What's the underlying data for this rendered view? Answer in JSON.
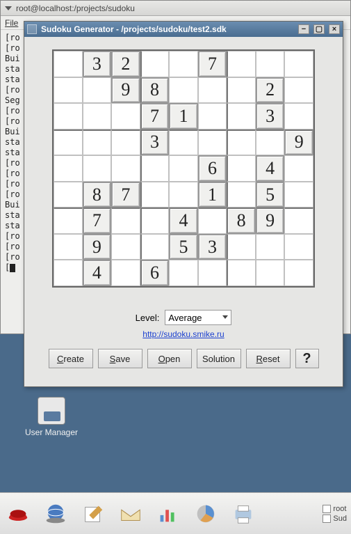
{
  "terminal": {
    "title": "root@localhost:/projects/sudoku",
    "menu_file": "File",
    "lines": [
      "[ro",
      "[ro",
      "Bui",
      "sta",
      "sta",
      "[ro",
      "Seg",
      "[ro",
      "[ro",
      "Bui",
      "sta",
      "sta",
      "[ro",
      "[ro",
      "[ro",
      "[ro",
      "Bui",
      "sta",
      "sta",
      "[ro",
      "[ro",
      "[ro"
    ]
  },
  "app": {
    "title": "Sudoku Generator - /projects/sudoku/test2.sdk",
    "level_label": "Level:",
    "level_value": "Average",
    "link": "http://sudoku.smike.ru",
    "buttons": {
      "create": "Create",
      "save": "Save",
      "open": "Open",
      "solution": "Solution",
      "reset": "Reset",
      "help": "?"
    }
  },
  "chart_data": {
    "type": "table",
    "title": "Sudoku givens (row, col 0-indexed, value)",
    "grid_size": 9,
    "givens": [
      {
        "r": 0,
        "c": 1,
        "v": 3
      },
      {
        "r": 0,
        "c": 2,
        "v": 2
      },
      {
        "r": 0,
        "c": 5,
        "v": 7
      },
      {
        "r": 1,
        "c": 2,
        "v": 9
      },
      {
        "r": 1,
        "c": 3,
        "v": 8
      },
      {
        "r": 1,
        "c": 7,
        "v": 2
      },
      {
        "r": 2,
        "c": 3,
        "v": 7
      },
      {
        "r": 2,
        "c": 4,
        "v": 1
      },
      {
        "r": 2,
        "c": 7,
        "v": 3
      },
      {
        "r": 3,
        "c": 3,
        "v": 3
      },
      {
        "r": 3,
        "c": 8,
        "v": 9
      },
      {
        "r": 4,
        "c": 5,
        "v": 6
      },
      {
        "r": 4,
        "c": 7,
        "v": 4
      },
      {
        "r": 5,
        "c": 1,
        "v": 8
      },
      {
        "r": 5,
        "c": 2,
        "v": 7
      },
      {
        "r": 5,
        "c": 5,
        "v": 1
      },
      {
        "r": 5,
        "c": 7,
        "v": 5
      },
      {
        "r": 6,
        "c": 1,
        "v": 7
      },
      {
        "r": 6,
        "c": 4,
        "v": 4
      },
      {
        "r": 6,
        "c": 6,
        "v": 8
      },
      {
        "r": 6,
        "c": 7,
        "v": 9
      },
      {
        "r": 7,
        "c": 1,
        "v": 9
      },
      {
        "r": 7,
        "c": 4,
        "v": 5
      },
      {
        "r": 7,
        "c": 5,
        "v": 3
      },
      {
        "r": 8,
        "c": 1,
        "v": 4
      },
      {
        "r": 8,
        "c": 3,
        "v": 6
      }
    ]
  },
  "desktop": {
    "user_manager": "User Manager"
  },
  "taskbar": {
    "right1": "root",
    "right2": "Sud"
  }
}
